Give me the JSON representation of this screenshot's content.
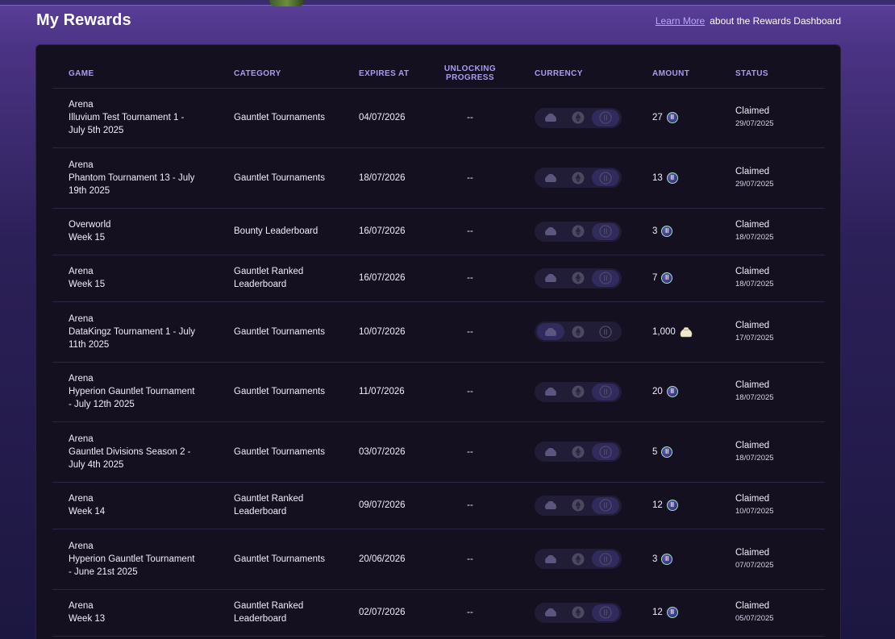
{
  "header": {
    "title": "My Rewards",
    "learn_more": "Learn More",
    "learn_more_suffix": "about the Rewards Dashboard"
  },
  "table": {
    "columns": {
      "game": "GAME",
      "category": "CATEGORY",
      "expires": "EXPIRES AT",
      "progress": "UNLOCKING PROGRESS",
      "currency": "CURRENCY",
      "amount": "AMOUNT",
      "status": "STATUS"
    },
    "rows": [
      {
        "game_line1": "Arena",
        "game_line2": "Illuvium Test Tournament 1 -",
        "game_line3": "July 5th 2025",
        "category_line1": "Gauntlet Tournaments",
        "category_line2": "",
        "expires": "04/07/2026",
        "progress": "--",
        "amount": "27",
        "currency_active": "ilv",
        "status": "Claimed",
        "status_date": "29/07/2025"
      },
      {
        "game_line1": "Arena",
        "game_line2": "Phantom Tournament 13 - July",
        "game_line3": "19th 2025",
        "category_line1": "Gauntlet Tournaments",
        "category_line2": "",
        "expires": "18/07/2026",
        "progress": "--",
        "amount": "13",
        "currency_active": "ilv",
        "status": "Claimed",
        "status_date": "29/07/2025"
      },
      {
        "game_line1": "Overworld",
        "game_line2": "Week 15",
        "game_line3": "",
        "category_line1": "Bounty Leaderboard",
        "category_line2": "",
        "expires": "16/07/2026",
        "progress": "--",
        "amount": "3",
        "currency_active": "ilv",
        "status": "Claimed",
        "status_date": "18/07/2025"
      },
      {
        "game_line1": "Arena",
        "game_line2": "Week 15",
        "game_line3": "",
        "category_line1": "Gauntlet Ranked",
        "category_line2": "Leaderboard",
        "expires": "16/07/2026",
        "progress": "--",
        "amount": "7",
        "currency_active": "ilv",
        "status": "Claimed",
        "status_date": "18/07/2025"
      },
      {
        "game_line1": "Arena",
        "game_line2": "DataKingz Tournament 1 - July",
        "game_line3": "11th 2025",
        "category_line1": "Gauntlet Tournaments",
        "category_line2": "",
        "expires": "10/07/2026",
        "progress": "--",
        "amount": "1,000",
        "currency_active": "pouch",
        "status": "Claimed",
        "status_date": "17/07/2025"
      },
      {
        "game_line1": "Arena",
        "game_line2": "Hyperion Gauntlet Tournament",
        "game_line3": "- July 12th 2025",
        "category_line1": "Gauntlet Tournaments",
        "category_line2": "",
        "expires": "11/07/2026",
        "progress": "--",
        "amount": "20",
        "currency_active": "ilv",
        "status": "Claimed",
        "status_date": "18/07/2025"
      },
      {
        "game_line1": "Arena",
        "game_line2": "Gauntlet Divisions Season 2 -",
        "game_line3": "July 4th 2025",
        "category_line1": "Gauntlet Tournaments",
        "category_line2": "",
        "expires": "03/07/2026",
        "progress": "--",
        "amount": "5",
        "currency_active": "ilv",
        "status": "Claimed",
        "status_date": "18/07/2025"
      },
      {
        "game_line1": "Arena",
        "game_line2": "Week 14",
        "game_line3": "",
        "category_line1": "Gauntlet Ranked",
        "category_line2": "Leaderboard",
        "expires": "09/07/2026",
        "progress": "--",
        "amount": "12",
        "currency_active": "ilv",
        "status": "Claimed",
        "status_date": "10/07/2025"
      },
      {
        "game_line1": "Arena",
        "game_line2": "Hyperion Gauntlet Tournament",
        "game_line3": "- June 21st 2025",
        "category_line1": "Gauntlet Tournaments",
        "category_line2": "",
        "expires": "20/06/2026",
        "progress": "--",
        "amount": "3",
        "currency_active": "ilv",
        "status": "Claimed",
        "status_date": "07/07/2025"
      },
      {
        "game_line1": "Arena",
        "game_line2": "Week 13",
        "game_line3": "",
        "category_line1": "Gauntlet Ranked",
        "category_line2": "Leaderboard",
        "expires": "02/07/2026",
        "progress": "--",
        "amount": "12",
        "currency_active": "ilv",
        "status": "Claimed",
        "status_date": "05/07/2025"
      }
    ]
  },
  "icons": {
    "pouch": "pouch-icon",
    "eth": "ethereum-icon",
    "ilv": "ilv-token-icon"
  },
  "colors": {
    "accent": "#a99cf4",
    "link": "#b7a6ff",
    "panel": "#14101f"
  }
}
